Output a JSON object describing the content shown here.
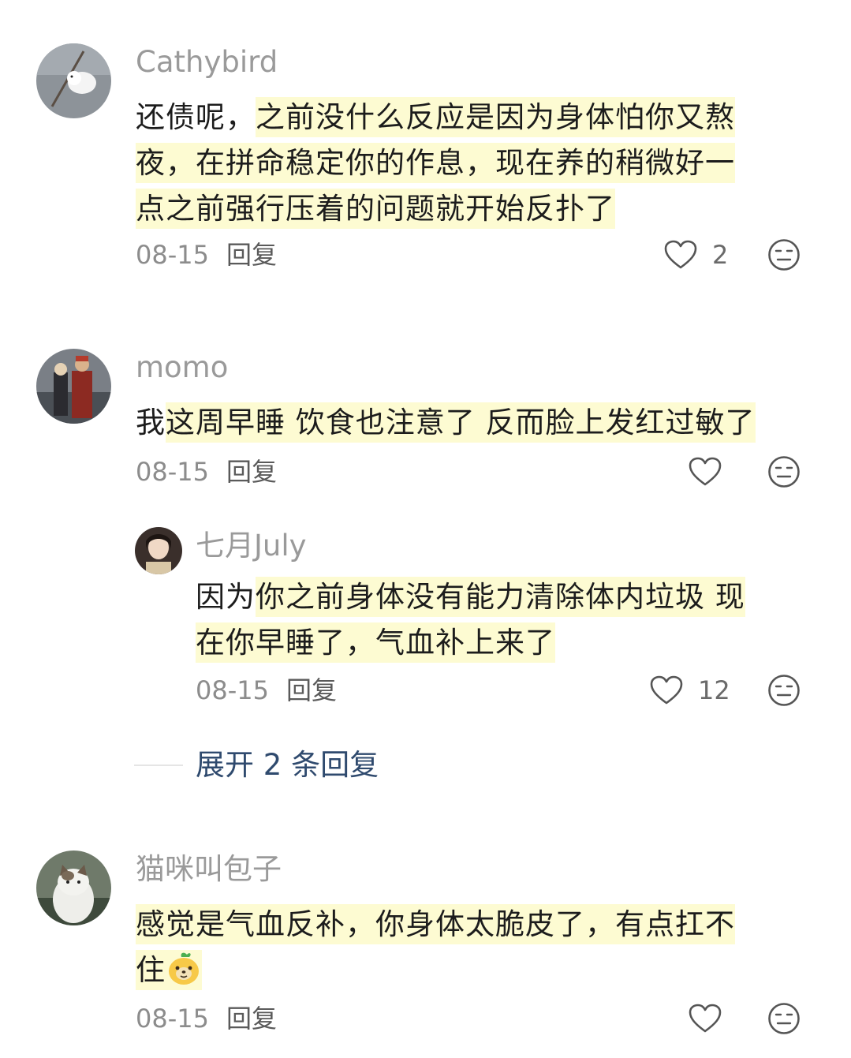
{
  "comments": [
    {
      "username": "Cathybird",
      "text_plain": "还债呢，",
      "text_lines": [
        "之前没什么反应是因为身体怕你又熬",
        "夜，在拼命稳定你的作息，现在养的稍微好一",
        "点之前强行压着的问题就开始反扑了"
      ],
      "date": "08-15",
      "reply_label": "回复",
      "like_count": "2",
      "avatar_icon": "white-bird-avatar"
    },
    {
      "username": "momo",
      "text_plain": "我",
      "text_lines": [
        "这周早睡 饮食也注意了 反而脸上发红过敏了"
      ],
      "date": "08-15",
      "reply_label": "回复",
      "like_count": "",
      "avatar_icon": "costume-photo-avatar"
    },
    {
      "username": "七月July",
      "text_plain": "因为",
      "text_lines": [
        "你之前身体没有能力清除体内垃圾 现",
        "在你早睡了，气血补上来了"
      ],
      "date": "08-15",
      "reply_label": "回复",
      "like_count": "12",
      "avatar_icon": "girl-portrait-avatar"
    },
    {
      "username": "猫咪叫包子",
      "text_plain": "",
      "text_lines": [
        "感觉是气血反补，你身体太脆皮了，有点扛不",
        "住"
      ],
      "date": "08-15",
      "reply_label": "回复",
      "like_count": "",
      "avatar_icon": "cat-avatar",
      "emoji": "smiling-fruit-emoji"
    }
  ],
  "expand_replies": {
    "label": "展开 2 条回复"
  },
  "colors": {
    "highlight": "#fdfbd2",
    "username": "#9a9a9a",
    "expand_link": "#2f4a6e"
  },
  "icons": {
    "like": "heart-outline-icon",
    "dislike": "meh-face-icon"
  }
}
